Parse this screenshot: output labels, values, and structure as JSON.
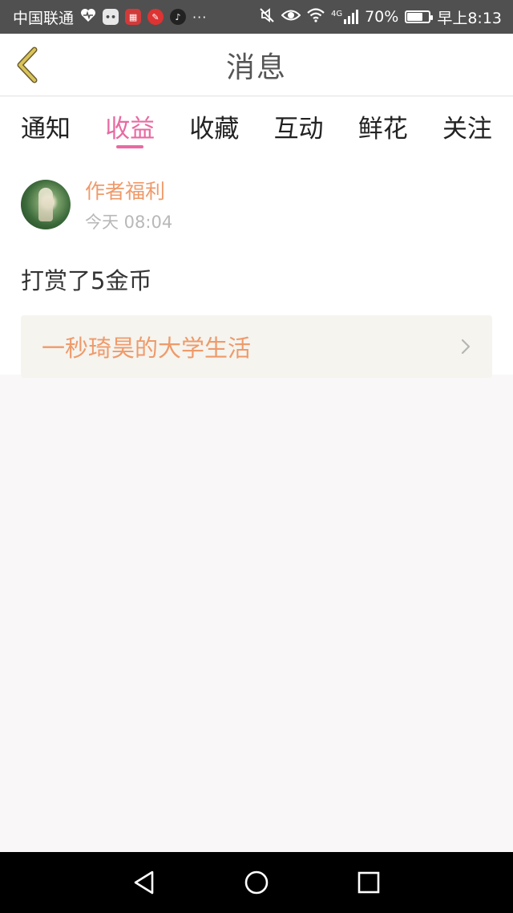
{
  "status_bar": {
    "carrier": "中国联通",
    "dots": "···",
    "network": "4G",
    "battery": "70%",
    "battery_fraction": 0.7,
    "time": "早上8:13"
  },
  "header": {
    "title": "消息"
  },
  "tabs": [
    {
      "label": "通知",
      "active": false
    },
    {
      "label": "收益",
      "active": true
    },
    {
      "label": "收藏",
      "active": false
    },
    {
      "label": "互动",
      "active": false
    },
    {
      "label": "鲜花",
      "active": false
    },
    {
      "label": "关注",
      "active": false
    }
  ],
  "message": {
    "author": "作者福利",
    "time": "今天 08:04",
    "body": "打赏了5金币",
    "book_title": "一秒琦昊的大学生活"
  },
  "colors": {
    "accent_pink": "#e86aa2",
    "accent_orange": "#ef9a6a",
    "back_arrow": "#c8a63a"
  },
  "icons": {
    "back": "back-arrow-icon",
    "chevron": "chevron-right-icon",
    "nav_back": "nav-back-icon",
    "nav_home": "nav-home-icon",
    "nav_recent": "nav-recent-icon"
  }
}
